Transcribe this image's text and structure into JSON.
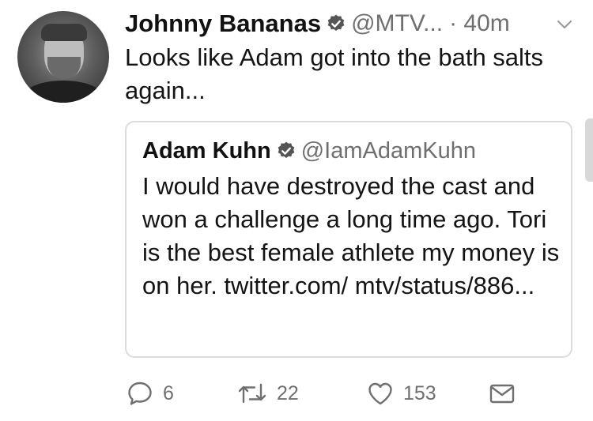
{
  "tweet": {
    "author_name": "Johnny Bananas",
    "author_handle": "@MTV...",
    "time": "· 40m",
    "text": "Looks like Adam got into the bath salts again..."
  },
  "quoted_tweet": {
    "author_name": "Adam Kuhn",
    "author_handle": "@IamAdamKuhn",
    "text": "I would have destroyed the cast and won a challenge a long time ago. Tori is the best female athlete my money is on her. twitter.com/ mtv/status/886..."
  },
  "actions": {
    "reply_count": "6",
    "retweet_count": "22",
    "like_count": "153"
  },
  "icons": {
    "verified": "verified-badge-icon",
    "caret": "chevron-down-icon",
    "reply": "reply-icon",
    "retweet": "retweet-icon",
    "like": "heart-icon",
    "message": "envelope-icon"
  },
  "colors": {
    "text": "#141414",
    "secondary_text": "#6f6f6f",
    "border": "#dcdcdc"
  }
}
